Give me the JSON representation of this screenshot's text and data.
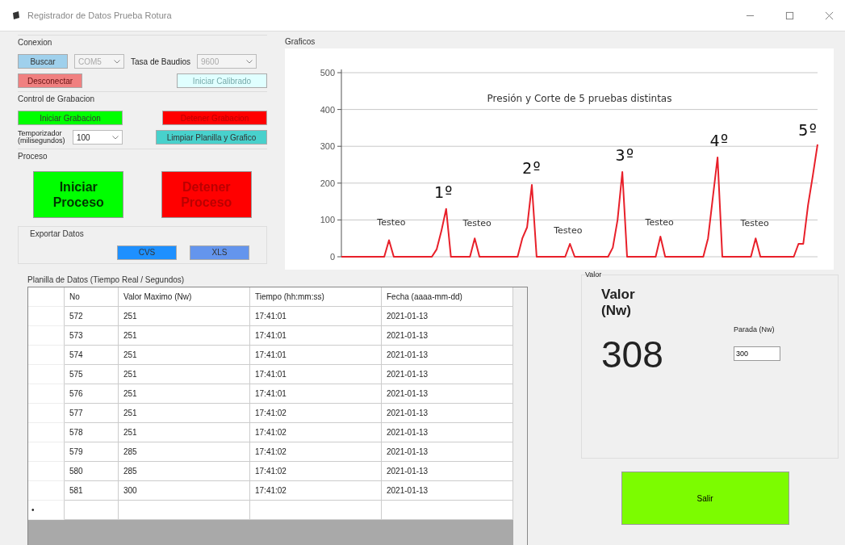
{
  "window": {
    "title": "Registrador de Datos Prueba Rotura"
  },
  "conexion": {
    "title": "Conexion",
    "buscar": "Buscar",
    "port": {
      "value": "COM5",
      "disabled": true
    },
    "baud_label": "Tasa de Baudios",
    "baud": {
      "value": "9600",
      "disabled": true
    },
    "desconectar": "Desconectar",
    "calibrar": "Iniciar Calibrado"
  },
  "grabacion": {
    "title": "Control de Grabacion",
    "iniciar": "Iniciar Grabacion",
    "detener": "Detener Grabacion",
    "timer_label": "Temporizador (milisegundos)",
    "timer": {
      "value": "100",
      "disabled": false
    },
    "limpiar": "Limpiar Planilla y Grafico"
  },
  "proceso": {
    "title": "Proceso",
    "iniciar": "Iniciar Proceso",
    "detener": "Detener Proceso"
  },
  "exportar": {
    "title": "Exportar Datos",
    "buttons": [
      {
        "label": "CVS",
        "color": "#1e90ff"
      },
      {
        "label": "XLS",
        "color": "#6495ed"
      }
    ]
  },
  "graficos": {
    "title": "Graficos",
    "chart_data": {
      "type": "line",
      "title": "Presión y Corte de 5 pruebas distintas",
      "ylim": [
        0,
        500
      ],
      "yticks": [
        0,
        100,
        200,
        300,
        400,
        500
      ],
      "grid": true,
      "categories": [
        null,
        null,
        null,
        null,
        null,
        null,
        null,
        null,
        null,
        null,
        null,
        null,
        null,
        null,
        null,
        null,
        null,
        null,
        null,
        null,
        null,
        null,
        null,
        null,
        null,
        null,
        null,
        null,
        null,
        null,
        null,
        null,
        null,
        null,
        null,
        null,
        null,
        null,
        null,
        null,
        null,
        null,
        null,
        null,
        null,
        null,
        null,
        null,
        null,
        null,
        null,
        null,
        null,
        null,
        null,
        null,
        null,
        null,
        null,
        null,
        null,
        null,
        null,
        null,
        null,
        null,
        null,
        null,
        null,
        null,
        null,
        null,
        null,
        null,
        null,
        null,
        null,
        null,
        null,
        null,
        null,
        null,
        null,
        null,
        null,
        null,
        null,
        null,
        null,
        null,
        null,
        null,
        null,
        null,
        null,
        null,
        null,
        null,
        null,
        null,
        null
      ],
      "series": [
        {
          "color": "#e8202a",
          "values": [
            0,
            0,
            0,
            0,
            0,
            0,
            0,
            0,
            0,
            0,
            45,
            0,
            0,
            0,
            0,
            0,
            0,
            0,
            0,
            0,
            20,
            70,
            130,
            0,
            0,
            0,
            0,
            0,
            50,
            0,
            0,
            0,
            0,
            0,
            0,
            0,
            0,
            0,
            50,
            80,
            195,
            0,
            0,
            0,
            0,
            0,
            0,
            0,
            35,
            0,
            0,
            0,
            0,
            0,
            0,
            0,
            0,
            25,
            100,
            230,
            0,
            0,
            0,
            0,
            0,
            0,
            0,
            55,
            0,
            0,
            0,
            0,
            0,
            0,
            0,
            0,
            0,
            50,
            160,
            270,
            0,
            0,
            0,
            0,
            0,
            0,
            0,
            50,
            0,
            0,
            0,
            0,
            0,
            0,
            0,
            0,
            35,
            35,
            140,
            220,
            305
          ]
        }
      ]
    },
    "labels": [
      {
        "text": "Testeo",
        "kind": "small"
      },
      {
        "text": "1º",
        "kind": "big"
      },
      {
        "text": "Testeo",
        "kind": "small"
      },
      {
        "text": "2º",
        "kind": "big"
      },
      {
        "text": "Testeo",
        "kind": "small"
      },
      {
        "text": "3º",
        "kind": "big"
      },
      {
        "text": "Testeo",
        "kind": "small"
      },
      {
        "text": "4º",
        "kind": "big"
      },
      {
        "text": "Testeo",
        "kind": "small"
      },
      {
        "text": "5º",
        "kind": "big"
      }
    ]
  },
  "planilla": {
    "title": "Planilla de Datos (Tiempo Real / Segundos)",
    "columns": [
      "No",
      "Valor Maximo (Nw)",
      "Tiempo (hh:mm:ss)",
      "Fecha (aaaa-mm-dd)"
    ],
    "rows": [
      [
        "572",
        "251",
        "17:41:01",
        "2021-01-13"
      ],
      [
        "573",
        "251",
        "17:41:01",
        "2021-01-13"
      ],
      [
        "574",
        "251",
        "17:41:01",
        "2021-01-13"
      ],
      [
        "575",
        "251",
        "17:41:01",
        "2021-01-13"
      ],
      [
        "576",
        "251",
        "17:41:01",
        "2021-01-13"
      ],
      [
        "577",
        "251",
        "17:41:02",
        "2021-01-13"
      ],
      [
        "578",
        "251",
        "17:41:02",
        "2021-01-13"
      ],
      [
        "579",
        "285",
        "17:41:02",
        "2021-01-13"
      ],
      [
        "580",
        "285",
        "17:41:02",
        "2021-01-13"
      ],
      [
        "581",
        "300",
        "17:41:02",
        "2021-01-13"
      ]
    ],
    "new_row_marker": "•"
  },
  "valor": {
    "title": "Valor",
    "label": "Valor (Nw)",
    "value": "308",
    "parada_label": "Parada (Nw)",
    "parada": "300"
  },
  "salir": "Salir"
}
